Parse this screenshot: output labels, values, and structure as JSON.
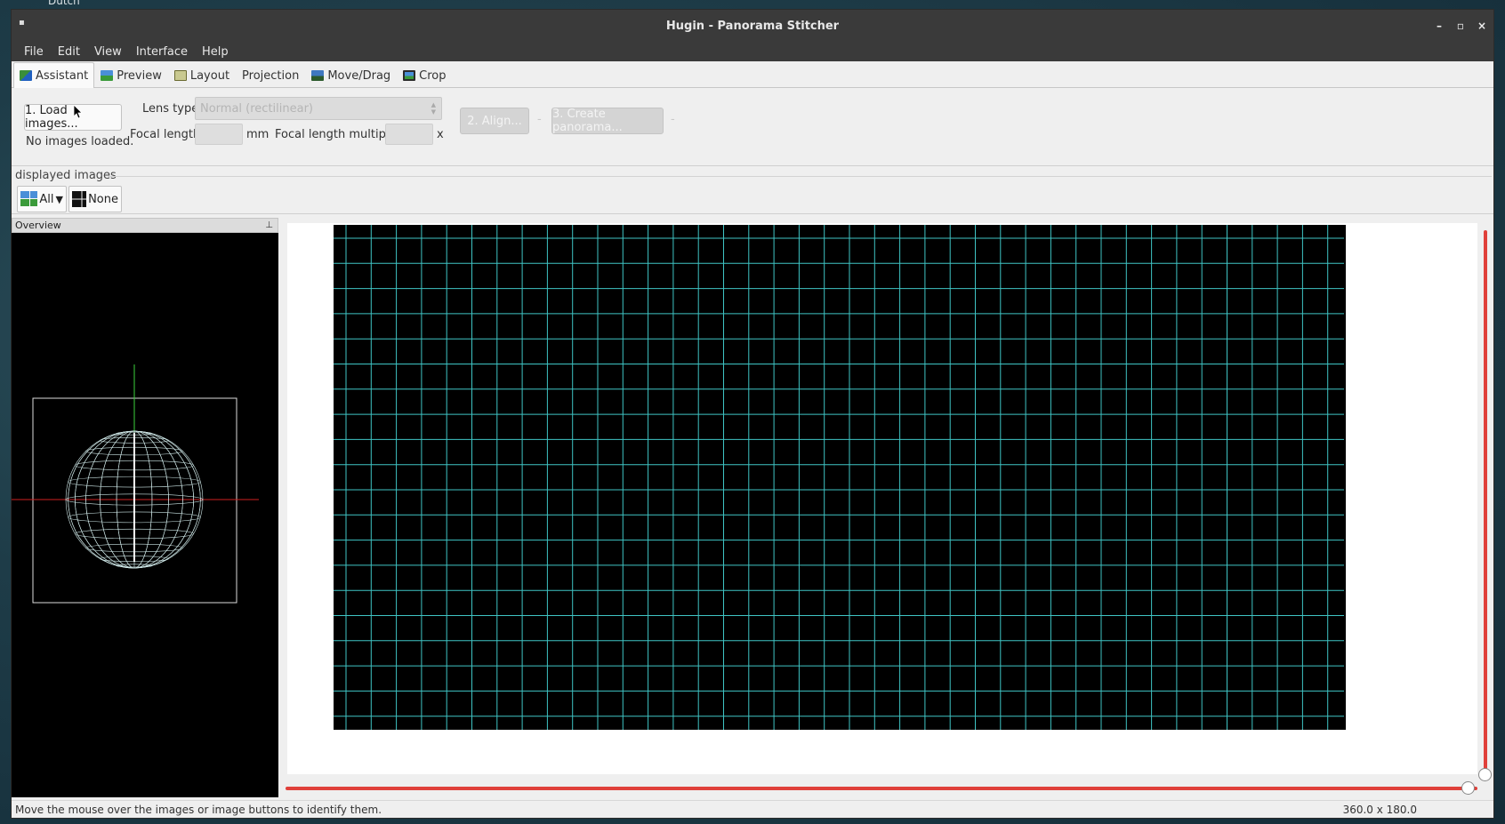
{
  "desktop": {
    "label": "Dutch"
  },
  "window": {
    "title": "Hugin - Panorama Stitcher",
    "controls": {
      "minimize": "–",
      "maximize": "▫",
      "close": "×"
    }
  },
  "menu": [
    "File",
    "Edit",
    "View",
    "Interface",
    "Help"
  ],
  "tabs": [
    {
      "label": "Assistant",
      "active": true,
      "icon": "assistant-icon"
    },
    {
      "label": "Preview",
      "active": false,
      "icon": "preview-icon"
    },
    {
      "label": "Layout",
      "active": false,
      "icon": "layout-icon"
    },
    {
      "label": "Projection",
      "active": false,
      "icon": ""
    },
    {
      "label": "Move/Drag",
      "active": false,
      "icon": "move-drag-icon"
    },
    {
      "label": "Crop",
      "active": false,
      "icon": "crop-icon"
    }
  ],
  "assistant": {
    "load_button": "1. Load images...",
    "status": "No images loaded.",
    "lens_type_label": "Lens type:",
    "lens_type_value": "Normal (rectilinear)",
    "focal_length_label": "Focal length:",
    "focal_length_unit": "mm",
    "focal_multiplier_label": "Focal length multiplier:",
    "focal_multiplier_unit": "x",
    "align_button": "2. Align...",
    "create_button": "3. Create panorama...",
    "separator": "-"
  },
  "displayed_images": {
    "title": "displayed images",
    "all_label": "All",
    "none_label": "None"
  },
  "overview": {
    "title": "Overview"
  },
  "status": {
    "message": "Move the mouse over the images or image buttons to identify them.",
    "fov": "360.0 x 180.0"
  },
  "colors": {
    "grid": "#3fc4c4",
    "slider": "#e0403a",
    "axis_green": "#3cd23c",
    "axis_red": "#d02020"
  }
}
